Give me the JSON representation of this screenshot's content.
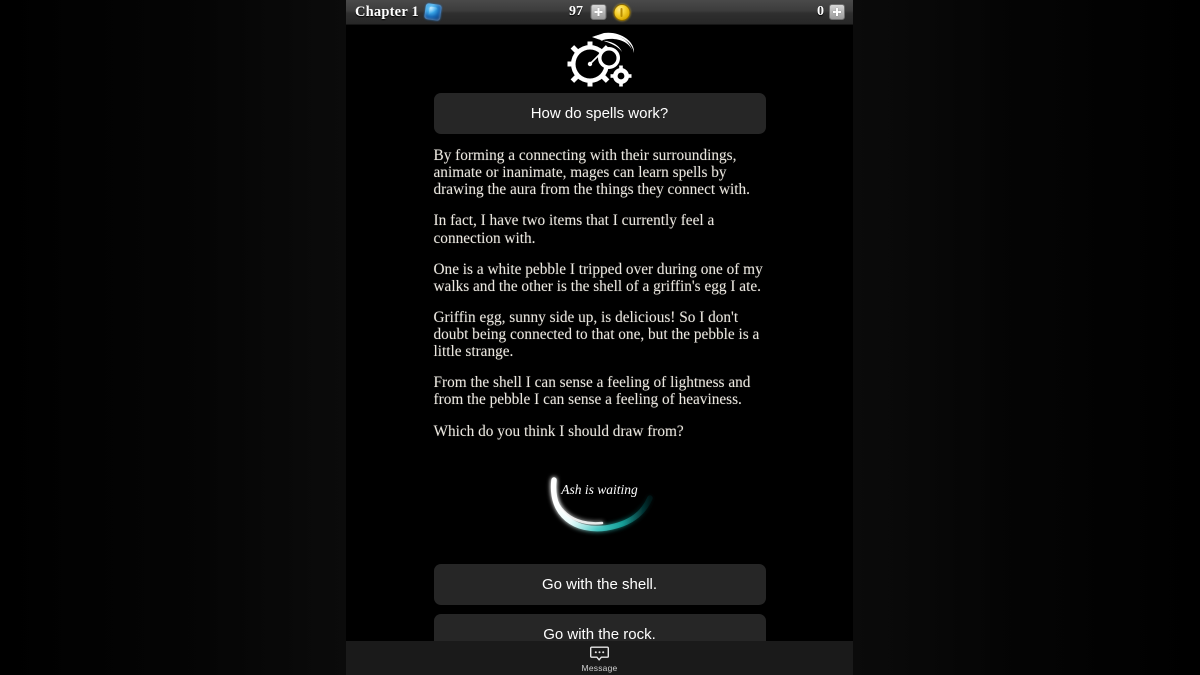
{
  "topbar": {
    "chapter_label": "Chapter 1",
    "chapter_icon": "gem-icon",
    "center_stat_value": "97",
    "center_stat_add_icon": "plus-icon",
    "currency_icon": "coin-icon",
    "right_stat_value": "0",
    "right_stat_add_icon": "plus-icon"
  },
  "emblem": {
    "icon": "moon-gear-emblem-icon"
  },
  "dialog": {
    "question_label": "How do spells work?",
    "paragraphs": [
      "By forming a connecting with their surroundings, animate or inanimate, mages can learn spells by drawing the aura from the things they connect with.",
      "In fact, I have two items that I currently feel a connection with.",
      "One is a white pebble I tripped over during one of my walks and the other is the shell of a griffin's egg I ate.",
      "Griffin egg, sunny side up, is delicious! So I don't doubt being connected to that one, but the pebble is a little strange.",
      "From the shell I can sense a feeling of lightness and from the pebble I can sense a feeling of heaviness.",
      "Which do you think I should draw from?"
    ]
  },
  "waiting": {
    "text": "Ash is waiting",
    "arc_color_bright": "#ffffff",
    "arc_color_tail": "#19b8b0"
  },
  "choices": [
    {
      "label": "Go with the shell."
    },
    {
      "label": "Go with the rock."
    }
  ],
  "bottombar": {
    "message_icon": "speech-bubble-icon",
    "message_label": "Message"
  },
  "colors": {
    "panel_background": "#000000",
    "button_background": "#262626",
    "topbar_background": "#3c3c3c",
    "bottombar_background": "#1a1a1a",
    "body_text": "#ece8e0"
  }
}
